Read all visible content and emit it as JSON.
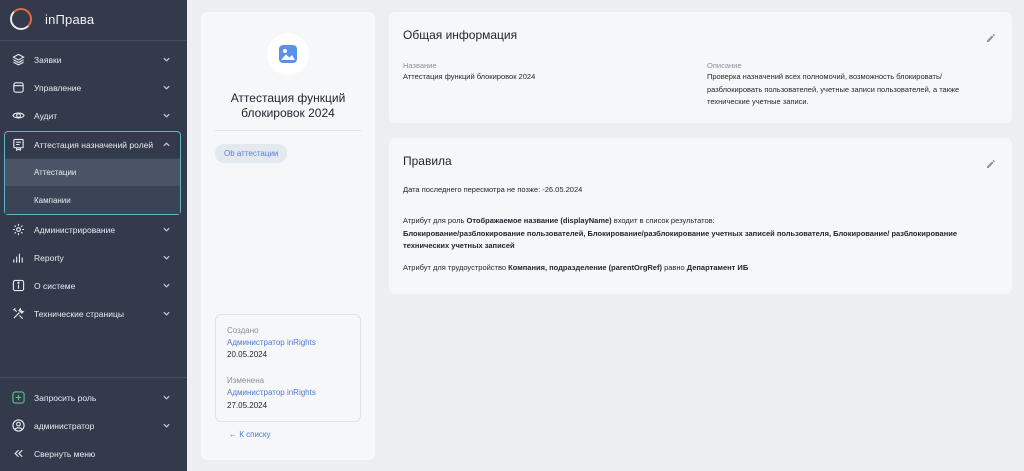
{
  "sidebar": {
    "brand": "inПрава",
    "items": [
      {
        "label": "Заявки",
        "icon": "layers-icon"
      },
      {
        "label": "Управление",
        "icon": "folder-icon"
      },
      {
        "label": "Аудит",
        "icon": "eye-icon"
      },
      {
        "label": "Аттестация назначений ролей",
        "icon": "attestation-icon"
      },
      {
        "label": "Администрирование",
        "icon": "gear-icon"
      },
      {
        "label": "Reporty",
        "icon": "bar-chart-icon"
      },
      {
        "label": "О системе",
        "icon": "info-icon"
      },
      {
        "label": "Технические страницы",
        "icon": "tools-icon"
      }
    ],
    "subitems": [
      {
        "label": "Аттестации",
        "active": true
      },
      {
        "label": "Кампании",
        "active": false
      }
    ],
    "bottom": [
      {
        "label": "Запросить роль",
        "icon": "plus-square-icon"
      },
      {
        "label": "администратор",
        "icon": "user-icon"
      },
      {
        "label": "Свернуть меню",
        "icon": "collapse-icon"
      }
    ]
  },
  "profile": {
    "title": "Аттестация функций блокировок 2024",
    "chip": "Ob аттестации",
    "created_label": "Создано",
    "created_by": "Администратор inRights",
    "created_date": "20.05.2024",
    "modified_label": "Изменена",
    "modified_by": "Администратор inRights",
    "modified_date": "27.05.2024",
    "back": "← К списку"
  },
  "general": {
    "title": "Общая информация",
    "name_label": "Название",
    "name_value": "Аттестация функций блокировок 2024",
    "desc_label": "Описание",
    "desc_value": "Проверка назначений всех полномочий, возможность блокировать/ разблокировать пользователей, учетные записи пользователей, а также технические учетные записи."
  },
  "rules": {
    "title": "Правила",
    "deadline": "Дата последнего пересмотра не позже: -26.05.2024",
    "r1_prefix": "Атрибут для роль ",
    "r1_attr": "Отображаемое название (displayName)",
    "r1_mid": " входит в список результатов:",
    "r1_values": "Блокирование/разблокирование пользователей, Блокирование/разблокирование учетных записей пользователя, Блокирование/ разблокирование технических учетных записей",
    "r2_prefix": "Атрибут для трудоустройство ",
    "r2_attr": "Компания, подразделение (parentOrgRef)",
    "r2_mid": " равно ",
    "r2_value": "Департамент ИБ"
  },
  "colors": {
    "sidebar_bg": "#323a4b",
    "accent_link": "#4f79d8",
    "group_border": "#5fb7c1",
    "brand_accent": "#e86a3d"
  }
}
